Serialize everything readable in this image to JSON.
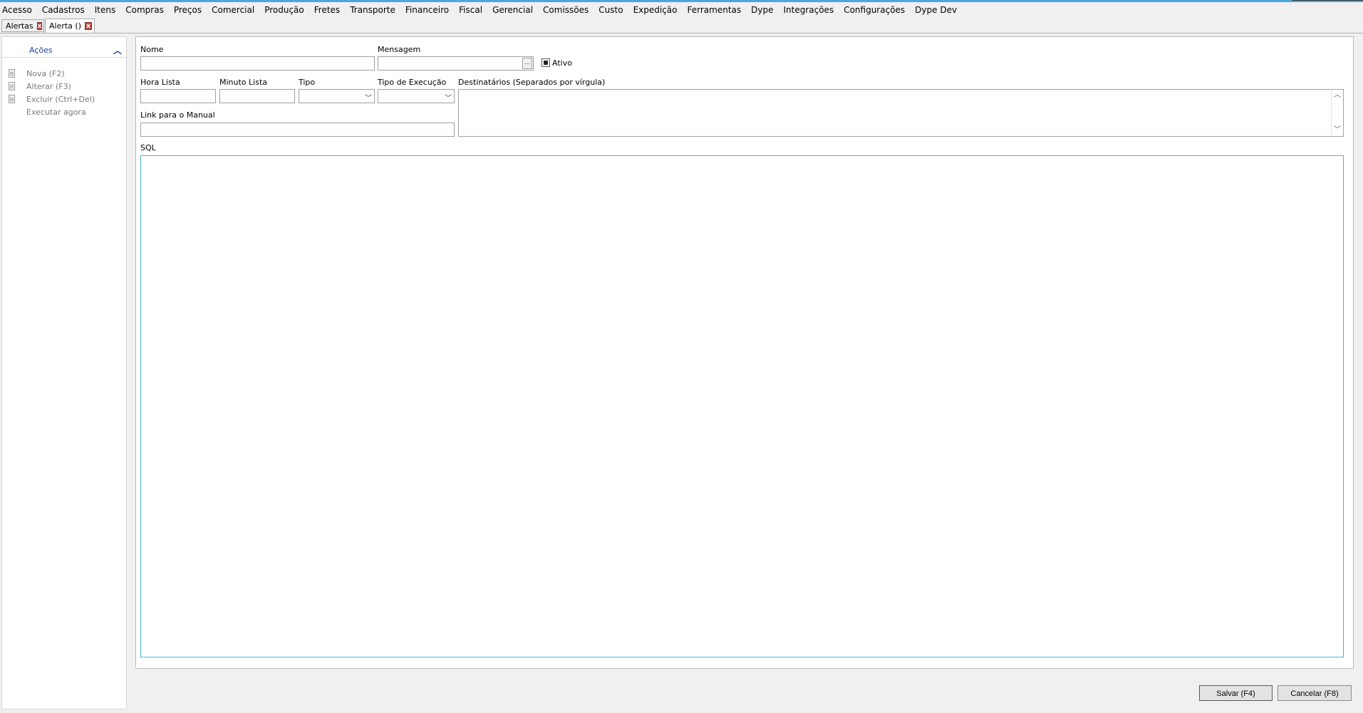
{
  "menubar": {
    "items": [
      "Acesso",
      "Cadastros",
      "Itens",
      "Compras",
      "Preços",
      "Comercial",
      "Produção",
      "Fretes",
      "Transporte",
      "Financeiro",
      "Fiscal",
      "Gerencial",
      "Comissões",
      "Custo",
      "Expedição",
      "Ferramentas",
      "Dype",
      "Integrações",
      "Configurações",
      "Dype Dev"
    ]
  },
  "tabs": [
    {
      "label": "Alertas",
      "close": "x",
      "active": false
    },
    {
      "label": "Alerta ()",
      "close": "x",
      "active": true
    }
  ],
  "sidebar": {
    "header": "Ações",
    "items": [
      {
        "label": "Nova (F2)",
        "icon": "document-icon"
      },
      {
        "label": "Alterar (F3)",
        "icon": "document-icon"
      },
      {
        "label": "Excluir (Ctrl+Del)",
        "icon": "document-icon"
      },
      {
        "label": "Executar agora",
        "icon": ""
      }
    ]
  },
  "form": {
    "nome_label": "Nome",
    "nome_value": "",
    "mensagem_label": "Mensagem",
    "mensagem_value": "",
    "mensagem_btn": "...",
    "ativo_label": "Ativo",
    "ativo_checked": true,
    "hora_lista_label": "Hora Lista",
    "hora_lista_value": "",
    "minuto_lista_label": "Minuto Lista",
    "minuto_lista_value": "",
    "tipo_label": "Tipo",
    "tipo_value": "",
    "tipo_execucao_label": "Tipo de Execução",
    "tipo_execucao_value": "",
    "destinatarios_label": "Destinatários (Separados por vírgula)",
    "destinatarios_value": "",
    "link_manual_label": "Link para o Manual",
    "link_manual_value": "",
    "sql_label": "SQL",
    "sql_value": ""
  },
  "footer": {
    "save_label": "Salvar (F4)",
    "cancel_label": "Cancelar (F8)"
  },
  "colors": {
    "accent": "#4aa8d8",
    "sql_border": "#4cb3d9",
    "sidebar_header": "#1f3f8f",
    "close_tab": "#c0504d"
  }
}
